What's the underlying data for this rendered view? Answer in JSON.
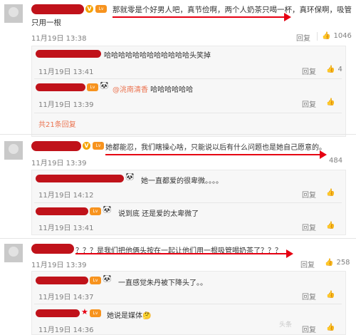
{
  "comments": [
    {
      "text": "那就零是个好男人吧，真节俭啊，两个人奶茶只喝一杯，真环保啊，吸管",
      "text2": "只用一根",
      "time": "11月19日 13:38",
      "reply": "回复",
      "likes": "1046",
      "replies": [
        {
          "text": "哈哈哈哈哈哈哈哈哈哈哈哈头笑掉",
          "time": "11月19日 13:41",
          "reply": "回复",
          "likes": "4"
        },
        {
          "mention": "@洮南清香",
          "text": " 哈哈哈哈哈哈",
          "time": "11月19日 13:39",
          "reply": "回复",
          "likes": ""
        }
      ],
      "more": "共21条回复"
    },
    {
      "text": "她都能忍，我们瞎操心啥，只能说以后有什么问题也是她自己愿意的。",
      "time": "11月19日 13:39",
      "reply": "回复",
      "likes": "484",
      "replies": [
        {
          "text": "她一直都爱的很卑微。。。。",
          "time": "11月19日 14:12",
          "reply": "回复",
          "likes": ""
        },
        {
          "text": "说到底 还是爱的太卑微了",
          "time": "11月19日 13:41",
          "reply": "回复",
          "likes": ""
        }
      ]
    },
    {
      "text": "？？？是我们把他俩头按在一起让他们用一根吸管喝奶茶了？？？",
      "time": "11月19日 13:39",
      "reply": "回复",
      "likes": "258",
      "replies": [
        {
          "text": "一直感觉朱丹被下降头了。。",
          "time": "11月19日 14:37",
          "reply": "回复",
          "likes": ""
        },
        {
          "text": "她说是媒体",
          "emoji": "🤔",
          "time": "11月19日 14:36",
          "reply": "回复",
          "likes": ""
        }
      ]
    }
  ],
  "icons": {
    "like": "thumbs-up-icon",
    "panda": "panda-emoji-icon",
    "verified": "verified-v-icon",
    "level": "level-badge-icon"
  },
  "colors": {
    "annotation_red": "#e60012",
    "redaction": "#c0121a",
    "link": "#eb7350"
  },
  "watermark": "头条"
}
